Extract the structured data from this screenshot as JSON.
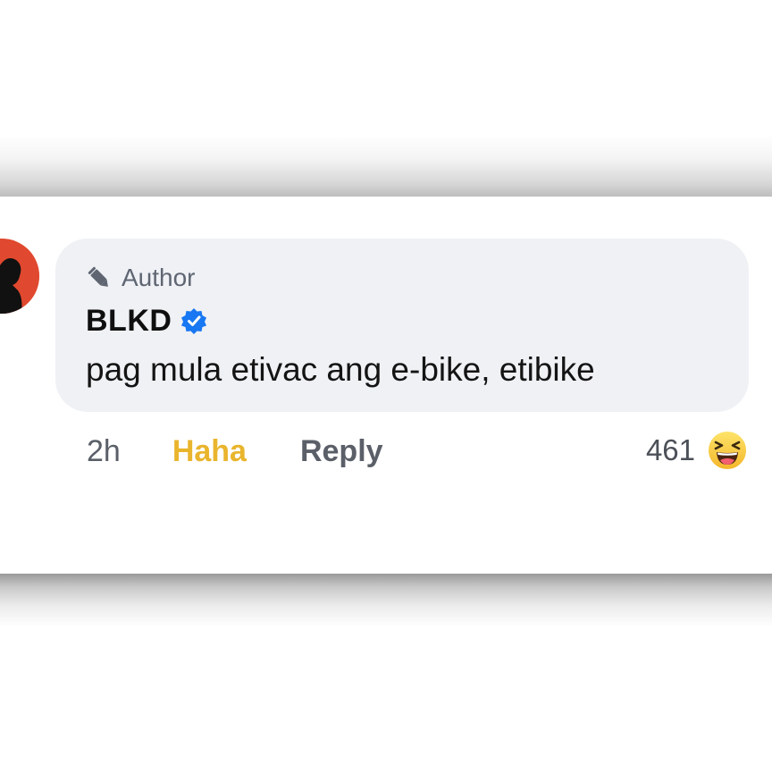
{
  "comment": {
    "author_badge": "Author",
    "name": "BLKD",
    "text": "pag mula etivac ang e-bike, etibike",
    "time": "2h",
    "reaction_label": "Haha",
    "reply_label": "Reply",
    "reaction_count": "461",
    "reaction_icon": "haha-emoji-icon"
  },
  "colors": {
    "bubble": "#eff1f5",
    "haha_label": "#e9b52d",
    "verified": "#1877f2",
    "avatar": "#e0492f"
  }
}
